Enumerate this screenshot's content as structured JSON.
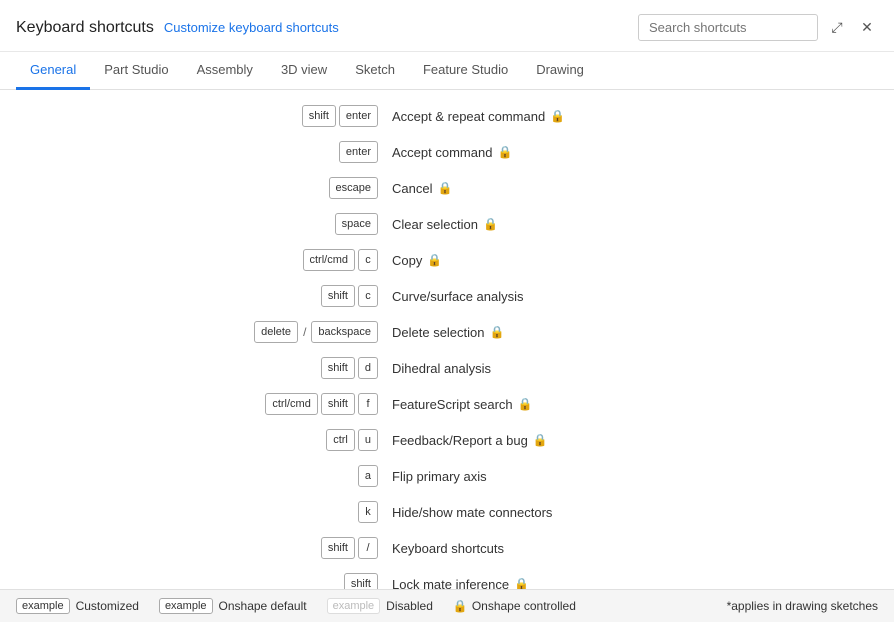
{
  "header": {
    "title": "Keyboard shortcuts",
    "customize_link": "Customize keyboard shortcuts",
    "search_placeholder": "Search shortcuts",
    "expand_icon": "⤢",
    "close_icon": "✕"
  },
  "tabs": [
    {
      "label": "General",
      "active": true
    },
    {
      "label": "Part Studio",
      "active": false
    },
    {
      "label": "Assembly",
      "active": false
    },
    {
      "label": "3D view",
      "active": false
    },
    {
      "label": "Sketch",
      "active": false
    },
    {
      "label": "Feature Studio",
      "active": false
    },
    {
      "label": "Drawing",
      "active": false
    }
  ],
  "shortcuts": [
    {
      "keys": [
        [
          "shift"
        ],
        [
          "enter"
        ]
      ],
      "label": "Accept & repeat command",
      "locked": true
    },
    {
      "keys": [
        [
          "enter"
        ]
      ],
      "label": "Accept command",
      "locked": true
    },
    {
      "keys": [
        [
          "escape"
        ]
      ],
      "label": "Cancel",
      "locked": true
    },
    {
      "keys": [
        [
          "space"
        ]
      ],
      "label": "Clear selection",
      "locked": true
    },
    {
      "keys": [
        [
          "ctrl/cmd"
        ],
        [
          "c"
        ]
      ],
      "label": "Copy",
      "locked": true
    },
    {
      "keys": [
        [
          "shift"
        ],
        [
          "c"
        ]
      ],
      "label": "Curve/surface analysis",
      "locked": false
    },
    {
      "keys": [
        [
          "delete"
        ],
        "/",
        [
          "backspace"
        ]
      ],
      "label": "Delete selection",
      "locked": true
    },
    {
      "keys": [
        [
          "shift"
        ],
        [
          "d"
        ]
      ],
      "label": "Dihedral analysis",
      "locked": false
    },
    {
      "keys": [
        [
          "ctrl/cmd"
        ],
        [
          "shift"
        ],
        [
          "f"
        ]
      ],
      "label": "FeatureScript search",
      "locked": true
    },
    {
      "keys": [
        [
          "ctrl"
        ],
        [
          "u"
        ]
      ],
      "label": "Feedback/Report a bug",
      "locked": true
    },
    {
      "keys": [
        [
          "a"
        ]
      ],
      "label": "Flip primary axis",
      "locked": false
    },
    {
      "keys": [
        [
          "k"
        ]
      ],
      "label": "Hide/show mate connectors",
      "locked": false
    },
    {
      "keys": [
        [
          "shift"
        ],
        [
          "/"
        ]
      ],
      "label": "Keyboard shortcuts",
      "locked": false
    },
    {
      "keys": [
        [
          "shift"
        ],
        [
          "..."
        ]
      ],
      "label": "Lock mate inference",
      "locked": true,
      "partial": true
    }
  ],
  "footer": {
    "customized_label": "example",
    "customized_desc": "Customized",
    "onshape_default_label": "example",
    "onshape_default_desc": "Onshape default",
    "disabled_label": "example",
    "disabled_desc": "Disabled",
    "onshape_controlled_desc": "Onshape controlled",
    "applies_note": "*applies in drawing sketches",
    "lock_symbol": "🔒"
  }
}
